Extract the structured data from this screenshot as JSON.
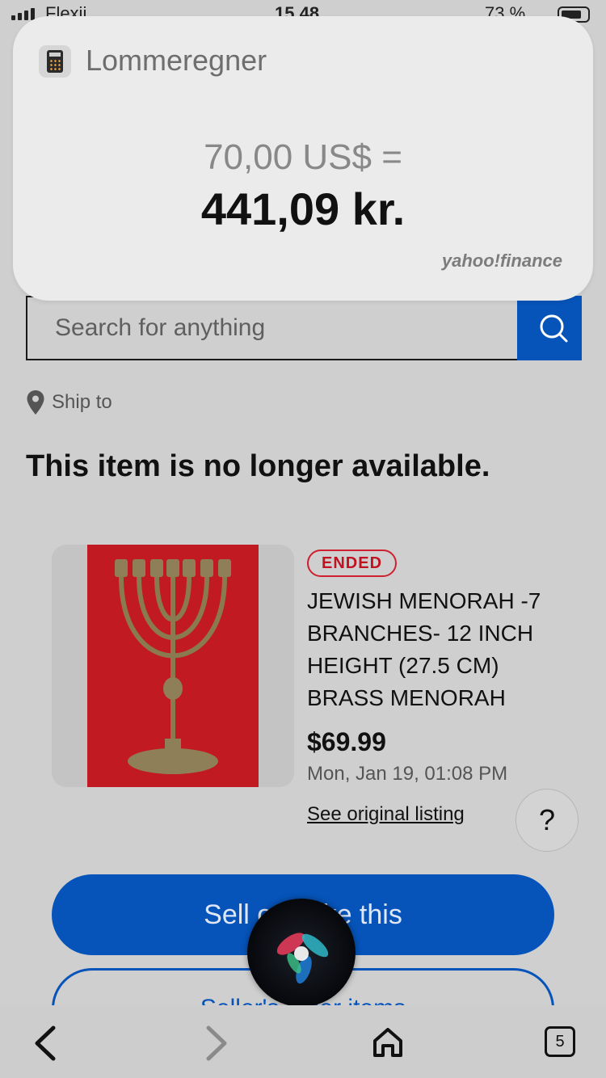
{
  "status_bar": {
    "carrier": "Flexii",
    "time": "15.48",
    "battery_percent": "73 %"
  },
  "notification": {
    "app_name": "Lommeregner",
    "query": "70,00 US$ =",
    "answer": "441,09 kr.",
    "brand": "yahoo!finance"
  },
  "search": {
    "placeholder": "Search for anything"
  },
  "ship_to": {
    "label": "Ship to"
  },
  "main": {
    "heading": "This item is no longer available."
  },
  "listing": {
    "status_badge": "ENDED",
    "title": "JEWISH MENORAH -7 BRANCHES- 12 INCH HEIGHT (27.5 CM) BRASS MENORAH",
    "price": "$69.99",
    "date": "Mon, Jan 19, 01:08 PM",
    "original_link": "See original listing"
  },
  "help": {
    "label": "?"
  },
  "buttons": {
    "sell_label": "Sell one like this",
    "seller_label": "Seller's other items"
  },
  "browser": {
    "tab_count": "5"
  },
  "colors": {
    "primary": "#0654ba",
    "ended": "#c01220",
    "product_bg": "#c11a22"
  }
}
